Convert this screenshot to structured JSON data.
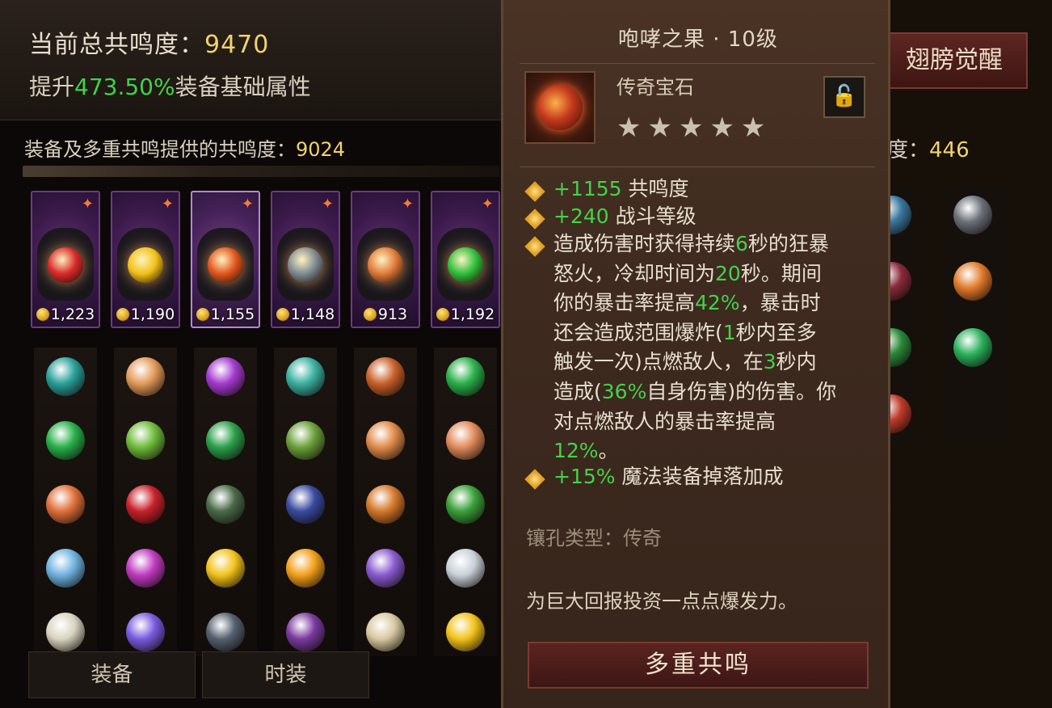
{
  "left_panel": {
    "total_label": "当前总共鸣度：",
    "total_value": "9470",
    "boost_prefix": "提升",
    "boost_percent": "473.50%",
    "boost_suffix": "装备基础属性",
    "equip_resonance_label": "装备及多重共鸣提供的共鸣度：",
    "equip_resonance_value": "9024",
    "slots": [
      {
        "score": "1,223",
        "gem_color": "#d92a2a"
      },
      {
        "score": "1,190",
        "gem_color": "#f2c21a"
      },
      {
        "score": "1,155",
        "gem_color": "#e2561e",
        "selected": true
      },
      {
        "score": "1,148",
        "gem_color": "#7f8c94"
      },
      {
        "score": "913",
        "gem_color": "#e07a3a"
      },
      {
        "score": "1,192",
        "gem_color": "#2fbf3a"
      }
    ],
    "gem_columns": [
      [
        "#2aa09a",
        "#27b04a",
        "#e0703a",
        "#6fb2e0",
        "#d9d4c0"
      ],
      [
        "#e49a5a",
        "#6dbb3a",
        "#c8212a",
        "#c03ac0",
        "#7a5ae0"
      ],
      [
        "#a43ad0",
        "#2aa04a",
        "#4a6a48",
        "#f2c21a",
        "#556070"
      ],
      [
        "#3ab0a0",
        "#6aa03a",
        "#3a4aa0",
        "#f2a01a",
        "#7a3aa0"
      ],
      [
        "#c9602a",
        "#e08a4a",
        "#d5782a",
        "#8a5ad0",
        "#d8c8a0"
      ],
      [
        "#2ab04a",
        "#e08a5a",
        "#3aa03a",
        "#c8d0d8",
        "#f2c21a"
      ]
    ],
    "tabs": [
      "装备",
      "时装"
    ]
  },
  "right_panel": {
    "awaken_button": "翅膀觉醒",
    "resonance_suffix": "度：",
    "resonance_value": "446",
    "gem_columns": [
      [
        "#3a78a0",
        "#8a2a3a",
        "#2a8a3a",
        "#c03a2a"
      ],
      [
        "#6a7078",
        "#e07a2a",
        "#2ab05a"
      ]
    ]
  },
  "tooltip": {
    "title": "咆哮之果 · 10级",
    "type": "传奇宝石",
    "stars": "★★★★★",
    "stats": [
      {
        "value": "+1155",
        "label": "共鸣度"
      },
      {
        "value": "+240",
        "label": "战斗等级"
      }
    ],
    "effect_lines": [
      [
        {
          "t": "造成伤害时获得持续"
        },
        {
          "t": "6",
          "g": true
        },
        {
          "t": "秒的狂暴"
        }
      ],
      [
        {
          "t": "怒火，冷却时间为"
        },
        {
          "t": "20",
          "g": true
        },
        {
          "t": "秒。期间"
        }
      ],
      [
        {
          "t": "你的暴击率提高"
        },
        {
          "t": "42%",
          "g": true
        },
        {
          "t": "，暴击时"
        }
      ],
      [
        {
          "t": "还会造成范围爆炸("
        },
        {
          "t": "1",
          "g": true
        },
        {
          "t": "秒内至多"
        }
      ],
      [
        {
          "t": "触发一次)点燃敌人，在"
        },
        {
          "t": "3",
          "g": true
        },
        {
          "t": "秒内"
        }
      ],
      [
        {
          "t": "造成("
        },
        {
          "t": "36%",
          "g": true
        },
        {
          "t": "自身伤害)的伤害。你"
        }
      ],
      [
        {
          "t": "对点燃敌人的暴击率提高"
        }
      ],
      [
        {
          "t": "12%",
          "g": true
        },
        {
          "t": "。"
        }
      ]
    ],
    "drop_bonus_value": "+15%",
    "drop_bonus_label": "魔法装备掉落加成",
    "socket_type": "镶孔类型：传奇",
    "flavor": "为巨大回报投资一点点爆发力。",
    "button": "多重共鸣"
  }
}
